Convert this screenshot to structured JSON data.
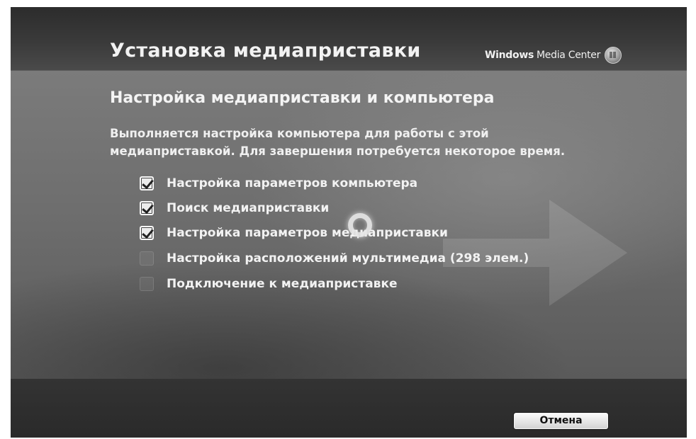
{
  "header": {
    "title": "Установка медиаприставки",
    "brand_bold": "Windows",
    "brand_text": "Media Center"
  },
  "main": {
    "subtitle": "Настройка медиаприставки и компьютера",
    "description_line1": "Выполняется настройка компьютера для работы с этой",
    "description_line2": "медиаприставкой. Для завершения потребуется некоторое время.",
    "steps": [
      {
        "label": "Настройка параметров компьютера",
        "checked": true
      },
      {
        "label": "Поиск медиаприставки",
        "checked": true
      },
      {
        "label": "Настройка параметров медиаприставки",
        "checked": true
      },
      {
        "label": "Настройка расположений мультимедиа (298 элем.)",
        "checked": false
      },
      {
        "label": "Подключение к медиаприставке",
        "checked": false
      }
    ]
  },
  "footer": {
    "cancel_label": "Отмена"
  },
  "icons": {
    "logo": "windows-media-center-logo-icon",
    "busy": "busy-spinner-icon",
    "check": "checkbox-checked-icon"
  }
}
